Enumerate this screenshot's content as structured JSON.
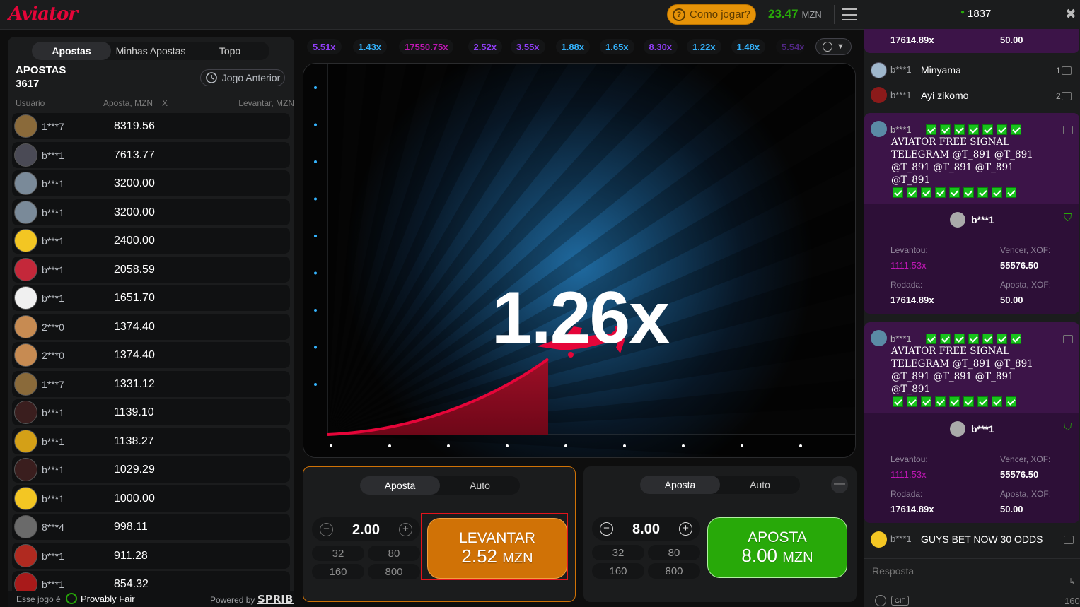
{
  "header": {
    "logo": "Aviator",
    "how_to_play": "Como jogar?",
    "balance": "23.47",
    "currency": "MZN"
  },
  "bets_panel": {
    "tabs": [
      "Apostas",
      "Minhas Apostas",
      "Topo"
    ],
    "title": "APOSTAS",
    "count": "3617",
    "previous_game": "Jogo Anterior",
    "columns": {
      "user": "Usuário",
      "bet": "Aposta, MZN",
      "x": "X",
      "cashout": "Levantar, MZN"
    },
    "rows": [
      {
        "user": "1***7",
        "amount": "8319.56"
      },
      {
        "user": "b***1",
        "amount": "7613.77"
      },
      {
        "user": "b***1",
        "amount": "3200.00"
      },
      {
        "user": "b***1",
        "amount": "3200.00"
      },
      {
        "user": "b***1",
        "amount": "2400.00"
      },
      {
        "user": "b***1",
        "amount": "2058.59"
      },
      {
        "user": "b***1",
        "amount": "1651.70"
      },
      {
        "user": "2***0",
        "amount": "1374.40"
      },
      {
        "user": "2***0",
        "amount": "1374.40"
      },
      {
        "user": "1***7",
        "amount": "1331.12"
      },
      {
        "user": "b***1",
        "amount": "1139.10"
      },
      {
        "user": "b***1",
        "amount": "1138.27"
      },
      {
        "user": "b***1",
        "amount": "1029.29"
      },
      {
        "user": "b***1",
        "amount": "1000.00"
      },
      {
        "user": "8***4",
        "amount": "998.11"
      },
      {
        "user": "b***1",
        "amount": "911.28"
      },
      {
        "user": "b***1",
        "amount": "854.32"
      }
    ],
    "footer_left": "Esse jogo é",
    "provably_fair": "Provably Fair",
    "powered_by": "Powered by",
    "brand": "SPRIBE"
  },
  "history": [
    {
      "v": "5.51x",
      "c": "#913ef8"
    },
    {
      "v": "1.43x",
      "c": "#34b4ff"
    },
    {
      "v": "17550.75x",
      "c": "#c017b4"
    },
    {
      "v": "2.52x",
      "c": "#913ef8"
    },
    {
      "v": "3.55x",
      "c": "#913ef8"
    },
    {
      "v": "1.88x",
      "c": "#34b4ff"
    },
    {
      "v": "1.65x",
      "c": "#34b4ff"
    },
    {
      "v": "8.30x",
      "c": "#913ef8"
    },
    {
      "v": "1.22x",
      "c": "#34b4ff"
    },
    {
      "v": "1.48x",
      "c": "#34b4ff"
    },
    {
      "v": "5.54x",
      "c": "#913ef8"
    }
  ],
  "game": {
    "multiplier": "1.26x"
  },
  "bet1": {
    "tabs": [
      "Aposta",
      "Auto"
    ],
    "stake": "2.00",
    "quick": [
      "32",
      "80",
      "160",
      "800"
    ],
    "btn_line1": "LEVANTAR",
    "btn_amount": "2.52",
    "btn_currency": "MZN"
  },
  "bet2": {
    "tabs": [
      "Aposta",
      "Auto"
    ],
    "stake": "8.00",
    "quick": [
      "32",
      "80",
      "160",
      "800"
    ],
    "btn_line1": "APOSTA",
    "btn_amount": "8.00",
    "btn_currency": "MZN"
  },
  "chat": {
    "online": "1837",
    "top_card": {
      "round": "17614.89x",
      "bet": "50.00"
    },
    "m1": {
      "user": "b***1",
      "text": "Minyama",
      "likes": "1"
    },
    "m2": {
      "user": "b***1",
      "text": "Ayi zikomo",
      "likes": "2"
    },
    "signal_user": "b***1",
    "signal_text": "AVIATOR FREE SIGNAL TELEGRAM @T_891 @T_891 @T_891 @T_891 @T_891 @T_891",
    "share": {
      "user": "b***1",
      "cashed_label": "Levantou:",
      "cashed": "1111.53x",
      "win_label": "Vencer, XOF:",
      "win": "55576.50",
      "round_label": "Rodada:",
      "round": "17614.89x",
      "bet_label": "Aposta, XOF:",
      "bet": "50.00"
    },
    "m3": {
      "user": "b***1",
      "text": "GUYS BET NOW 30 ODDS"
    },
    "reply_placeholder": "Resposta",
    "gif": "GIF",
    "counter": "160"
  },
  "colors": {
    "accent": "#e50539",
    "green": "#28a909",
    "orange": "#d07206",
    "purple_card": "#3c1448"
  }
}
